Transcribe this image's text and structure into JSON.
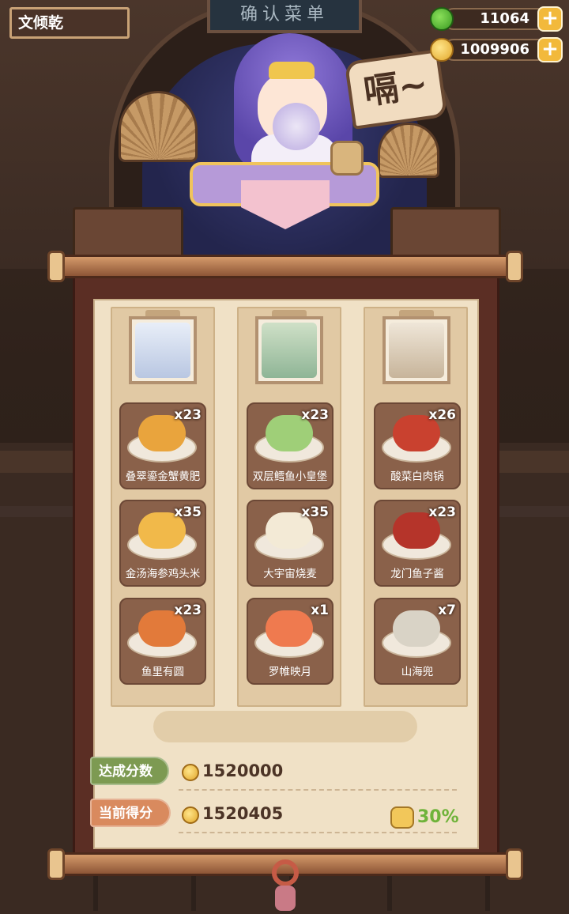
{
  "header": {
    "player_name": "文倾乾",
    "sign_text": "确认菜单"
  },
  "currencies": [
    {
      "name": "jade",
      "value": "11064",
      "color": "#5cc23a"
    },
    {
      "name": "coins",
      "value": "1009906",
      "color": "#f0c23d"
    }
  ],
  "character": {
    "speech": "嗝~"
  },
  "columns": [
    {
      "dishes": [
        {
          "name": "叠翠鎏金蟹黄肥",
          "count": "x23",
          "food_color": "#e9a43d"
        },
        {
          "name": "金汤海参鸡头米",
          "count": "x35",
          "food_color": "#f1b94a"
        },
        {
          "name": "鱼里有圆",
          "count": "x23",
          "food_color": "#e27a3a"
        }
      ]
    },
    {
      "dishes": [
        {
          "name": "双层鳕鱼小皇堡",
          "count": "x23",
          "food_color": "#9fcf78"
        },
        {
          "name": "大宇宙烧麦",
          "count": "x35",
          "food_color": "#f3ead6"
        },
        {
          "name": "罗帷映月",
          "count": "x1",
          "food_color": "#ef7a4f"
        }
      ]
    },
    {
      "dishes": [
        {
          "name": "酸菜白肉锅",
          "count": "x26",
          "food_color": "#c9412f"
        },
        {
          "name": "龙门鱼子酱",
          "count": "x23",
          "food_color": "#b5342a"
        },
        {
          "name": "山海兜",
          "count": "x7",
          "food_color": "#d9d3c6"
        }
      ]
    }
  ],
  "score": {
    "target_label": "达成分数",
    "target_value": "1520000",
    "target_color": "#7d9a52",
    "current_label": "当前得分",
    "current_value": "1520405",
    "current_color": "#d98a5e",
    "bonus_percent": "30%",
    "bonus_color": "#6fb33a"
  }
}
